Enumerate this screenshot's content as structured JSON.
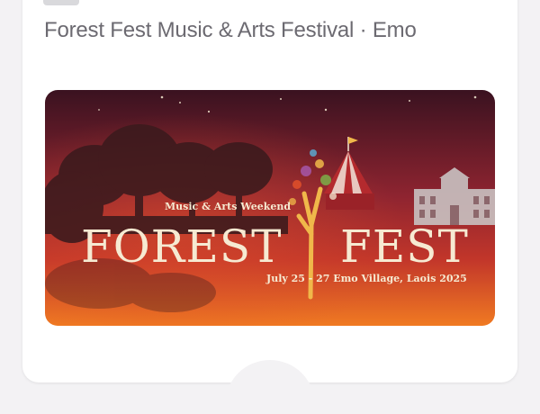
{
  "event": {
    "title": "Forest Fest Music & Arts Festival · Emo"
  },
  "banner": {
    "tagline": "Music & Arts Weekend",
    "word_left": "FOREST",
    "word_right": "FEST",
    "dates_location": "July 25 - 27 Emo Village, Laois 2025"
  },
  "colors": {
    "banner_top": "#3a1220",
    "banner_mid": "#c2362a",
    "banner_bottom": "#f07a22",
    "text_cream": "#f6ead2",
    "tree_gold": "#f0b84a"
  }
}
